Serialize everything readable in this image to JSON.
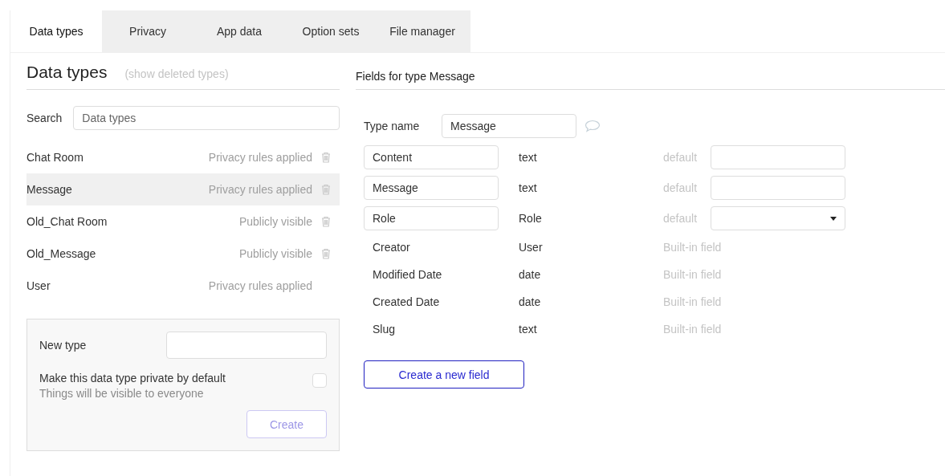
{
  "tabs": [
    {
      "label": "Data types",
      "selected": true
    },
    {
      "label": "Privacy",
      "selected": false
    },
    {
      "label": "App data",
      "selected": false
    },
    {
      "label": "Option sets",
      "selected": false
    },
    {
      "label": "File manager",
      "selected": false
    }
  ],
  "left": {
    "title": "Data types",
    "show_deleted": "(show deleted types)",
    "search_label": "Search",
    "search_placeholder": "Data types",
    "types": [
      {
        "name": "Chat Room",
        "status": "Privacy rules applied",
        "deletable": true,
        "selected": false
      },
      {
        "name": "Message",
        "status": "Privacy rules applied",
        "deletable": true,
        "selected": true
      },
      {
        "name": "Old_Chat Room",
        "status": "Publicly visible",
        "deletable": true,
        "selected": false
      },
      {
        "name": "Old_Message",
        "status": "Publicly visible",
        "deletable": true,
        "selected": false
      },
      {
        "name": "User",
        "status": "Privacy rules applied",
        "deletable": false,
        "selected": false
      }
    ],
    "new_type": {
      "label": "New type",
      "private_label": "Make this data type private by default",
      "private_hint": "Things will be visible to everyone",
      "checked": false,
      "button": "Create",
      "disabled": true
    }
  },
  "right": {
    "title": "Fields for type Message",
    "type_name_label": "Type name",
    "type_name": "Message",
    "fields": [
      {
        "kind": "custom",
        "name": "Content",
        "type": "text",
        "default_label": "default"
      },
      {
        "kind": "custom",
        "name": "Message",
        "type": "text",
        "default_label": "default"
      },
      {
        "kind": "custom_select",
        "name": "Role",
        "type": "Role",
        "default_label": "default"
      },
      {
        "kind": "builtin",
        "name": "Creator",
        "type": "User",
        "note": "Built-in field"
      },
      {
        "kind": "builtin",
        "name": "Modified Date",
        "type": "date",
        "note": "Built-in field"
      },
      {
        "kind": "builtin",
        "name": "Created Date",
        "type": "date",
        "note": "Built-in field"
      },
      {
        "kind": "builtin",
        "name": "Slug",
        "type": "text",
        "note": "Built-in field"
      }
    ],
    "new_field_button": "Create a new field"
  }
}
